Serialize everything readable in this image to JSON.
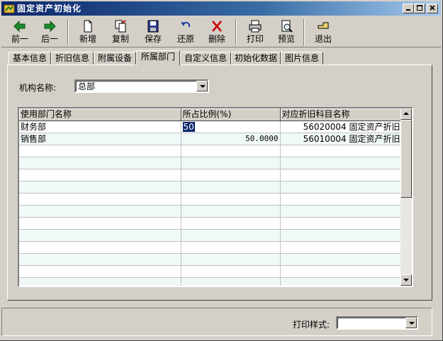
{
  "window": {
    "title": "固定资产初始化",
    "controls": [
      "minimize-icon",
      "maximize-icon",
      "close-icon"
    ]
  },
  "toolbar": {
    "buttons": [
      {
        "label": "前一",
        "icon": "arrow-left-icon",
        "color": "#1e8c2e"
      },
      {
        "label": "后一",
        "icon": "arrow-right-icon",
        "color": "#1e8c2e"
      },
      {
        "label": "新增",
        "icon": "new-document-icon"
      },
      {
        "label": "复制",
        "icon": "copy-icon"
      },
      {
        "label": "保存",
        "icon": "save-icon"
      },
      {
        "label": "还原",
        "icon": "undo-icon"
      },
      {
        "label": "删除",
        "icon": "delete-icon",
        "color": "#cc0000"
      },
      {
        "label": "打印",
        "icon": "print-icon"
      },
      {
        "label": "预览",
        "icon": "preview-icon"
      },
      {
        "label": "退出",
        "icon": "exit-icon"
      }
    ]
  },
  "tabs": [
    {
      "label": "基本信息",
      "active": false
    },
    {
      "label": "折旧信息",
      "active": false
    },
    {
      "label": "附属设备",
      "active": false
    },
    {
      "label": "所属部门",
      "active": true
    },
    {
      "label": "自定义信息",
      "active": false
    },
    {
      "label": "初始化数据",
      "active": false
    },
    {
      "label": "图片信息",
      "active": false
    }
  ],
  "org": {
    "label": "机构名称:",
    "value": "总部"
  },
  "grid": {
    "columns": [
      "使用部门名称",
      "所占比例(%)",
      "对应折旧科目名称"
    ],
    "rows": [
      {
        "dept": "财务部",
        "ratio": "50",
        "account": "56020004 固定资产折旧",
        "editing": true
      },
      {
        "dept": "销售部",
        "ratio": "50.0000",
        "account": "56010004 固定资产折旧",
        "editing": false
      }
    ],
    "empty_rows": 12
  },
  "footer": {
    "print_style_label": "打印样式:",
    "print_style_value": ""
  }
}
